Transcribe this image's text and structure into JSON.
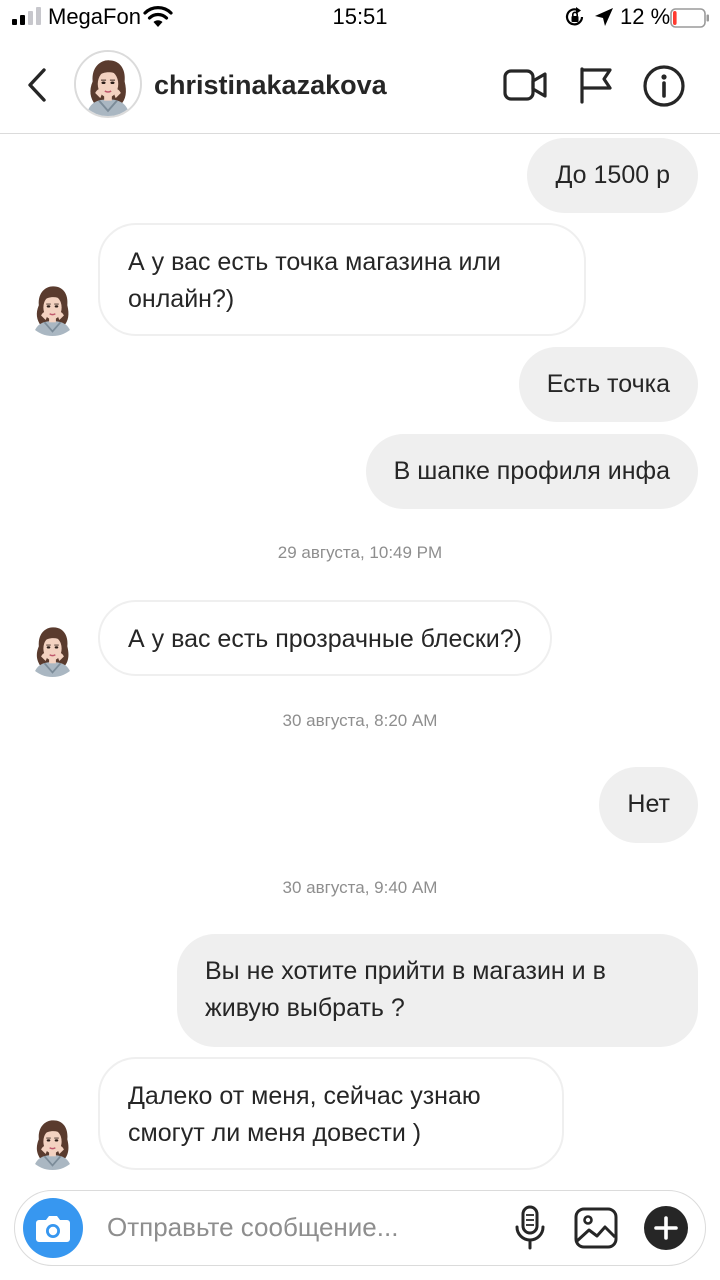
{
  "status_bar": {
    "carrier": "MegaFon",
    "time": "15:51",
    "battery_percent": "12 %",
    "battery_level": 0.12,
    "icons": [
      "signal-icon",
      "wifi-icon",
      "orientation-lock-icon",
      "location-icon",
      "battery-icon"
    ]
  },
  "header": {
    "username": "christinakazakova",
    "icons": [
      "back-icon",
      "video-call-icon",
      "flag-icon",
      "info-icon"
    ]
  },
  "messages": [
    {
      "type": "outgoing",
      "text": "До 1500 р"
    },
    {
      "type": "incoming",
      "text": "А у вас есть точка магазина или онлайн?)"
    },
    {
      "type": "outgoing",
      "text": "Есть точка"
    },
    {
      "type": "outgoing",
      "text": "В шапке профиля инфа"
    },
    {
      "type": "timestamp",
      "text": "29 августа, 10:49 PM"
    },
    {
      "type": "incoming",
      "text": "А у вас есть прозрачные блески?)"
    },
    {
      "type": "timestamp",
      "text": "30 августа, 8:20 AM"
    },
    {
      "type": "outgoing",
      "text": "Нет"
    },
    {
      "type": "timestamp",
      "text": "30 августа, 9:40 AM"
    },
    {
      "type": "outgoing",
      "text": "Вы не хотите прийти в магазин и в живую выбрать ?"
    },
    {
      "type": "incoming",
      "text": "Далеко от меня, сейчас узнаю смогут ли меня довести )"
    }
  ],
  "composer": {
    "placeholder": "Отправьте сообщение...",
    "icons": [
      "camera-icon",
      "microphone-icon",
      "gallery-icon",
      "plus-icon"
    ]
  },
  "colors": {
    "accent": "#3797f0",
    "outgoing_bubble": "#efefef",
    "text": "#262626",
    "muted": "#8e8e8e",
    "battery_low": "#ff3b30"
  }
}
